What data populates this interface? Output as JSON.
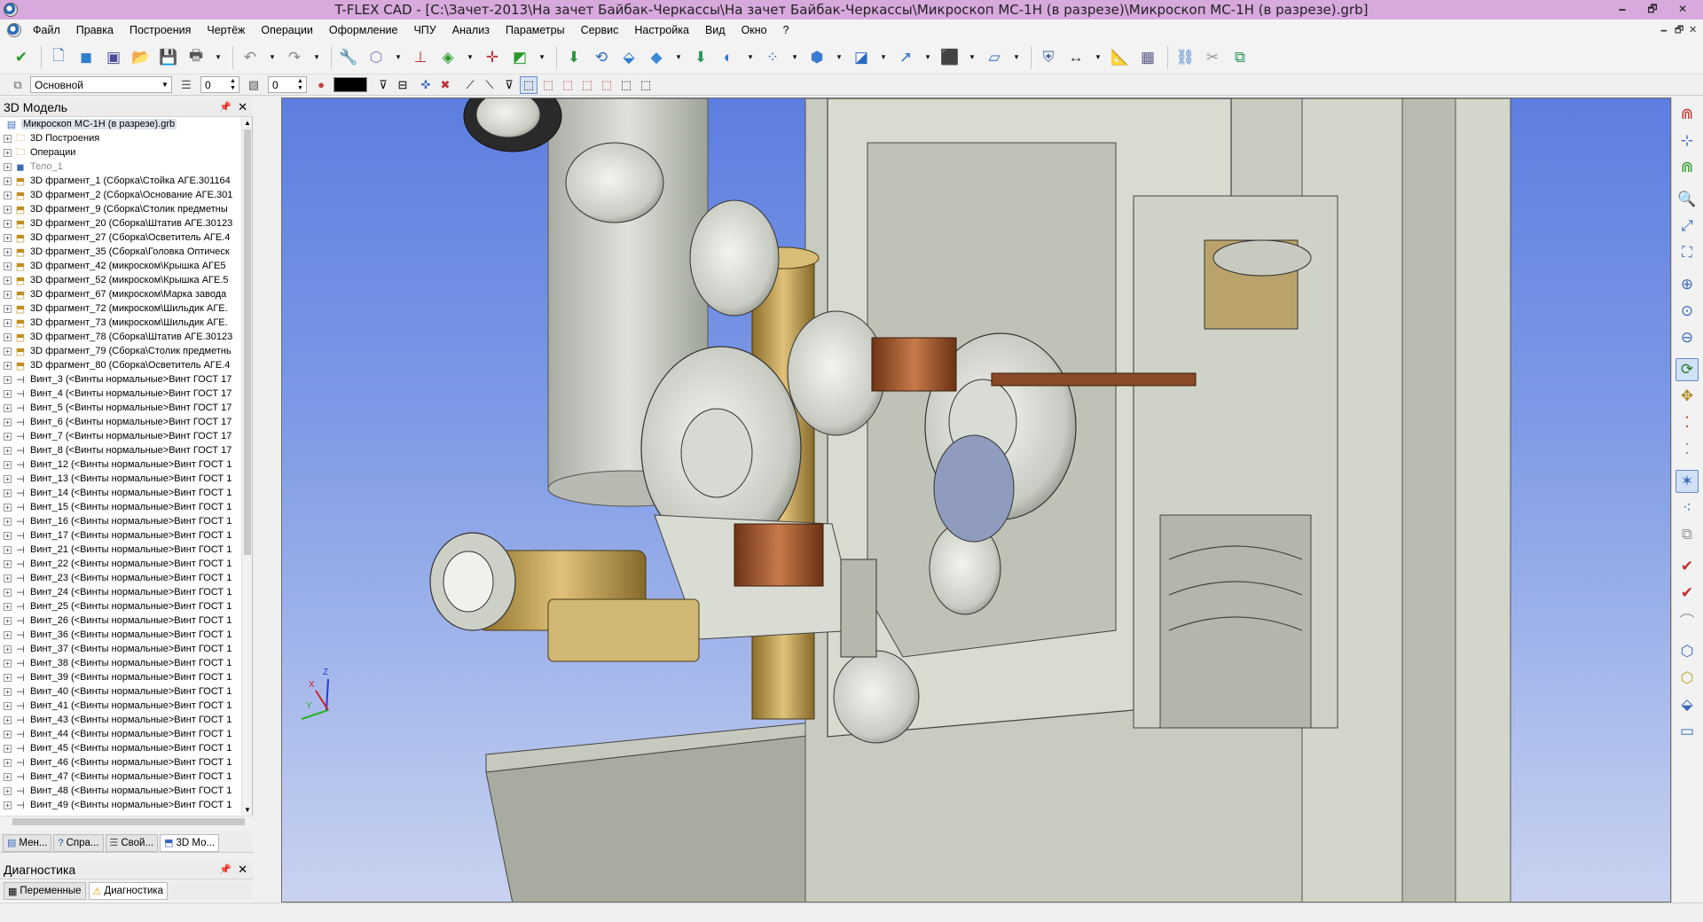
{
  "window": {
    "title": "T-FLEX CAD - [C:\\Зачет-2013\\На зачет Байбак-Черкассы\\На зачет Байбак-Черкассы\\Микроскоп МС-1Н (в разрезе)\\Микроскоп МС-1Н (в разрезе).grb]",
    "minimize": "🗕",
    "restore": "🗗",
    "close": "✕"
  },
  "menu": {
    "items": [
      "Файл",
      "Правка",
      "Построения",
      "Чертёж",
      "Операции",
      "Оформление",
      "ЧПУ",
      "Анализ",
      "Параметры",
      "Сервис",
      "Настройка",
      "Вид",
      "Окно",
      "?"
    ],
    "mdi_minimize": "🗕",
    "mdi_restore": "🗗",
    "mdi_close": "✕"
  },
  "toolbar2": {
    "layer": "Основной",
    "spin1": "0",
    "spin2": "0"
  },
  "model_panel": {
    "title": "3D Модель",
    "pin": "📌",
    "close": "✕",
    "tree": [
      {
        "label": "Микроскоп МС-1Н (в разрезе).grb",
        "icon": "document-icon",
        "root": true
      },
      {
        "label": "3D Построения",
        "icon": "folder-icon"
      },
      {
        "label": "Операции",
        "icon": "folder-icon"
      },
      {
        "label": "Тело_1",
        "icon": "body-icon",
        "dim": true
      },
      {
        "label": "3D фрагмент_1 (Сборка\\Стойка АГЕ.301164",
        "icon": "fragment-icon"
      },
      {
        "label": "3D фрагмент_2 (Сборка\\Основание АГЕ.301",
        "icon": "fragment-icon"
      },
      {
        "label": "3D фрагмент_9 (Сборка\\Столик предметны",
        "icon": "fragment-icon"
      },
      {
        "label": "3D фрагмент_20 (Сборка\\Штатив АГЕ.30123",
        "icon": "fragment-icon"
      },
      {
        "label": "3D фрагмент_27 (Сборка\\Осветитель АГЕ.4",
        "icon": "fragment-icon"
      },
      {
        "label": "3D фрагмент_35 (Сборка\\Головка Оптическ",
        "icon": "fragment-icon"
      },
      {
        "label": "3D фрагмент_42 (микроском\\Крышка АГЕ5",
        "icon": "fragment-icon"
      },
      {
        "label": "3D фрагмент_52 (микроском\\Крышка АГЕ.5",
        "icon": "fragment-icon"
      },
      {
        "label": "3D фрагмент_67 (микроском\\Марка завода",
        "icon": "fragment-icon"
      },
      {
        "label": "3D фрагмент_72 (микроском\\Шильдик АГЕ.",
        "icon": "fragment-icon"
      },
      {
        "label": "3D фрагмент_73 (микроском\\Шильдик АГЕ.",
        "icon": "fragment-icon"
      },
      {
        "label": "3D фрагмент_78 (Сборка\\Штатив АГЕ.30123",
        "icon": "fragment-icon"
      },
      {
        "label": "3D фрагмент_79 (Сборка\\Столик предметнь",
        "icon": "fragment-icon"
      },
      {
        "label": "3D фрагмент_80 (Сборка\\Осветитель АГЕ.4",
        "icon": "fragment-icon"
      },
      {
        "label": "Винт_3 (<Винты нормальные>Винт ГОСТ 17",
        "icon": "screw-icon"
      },
      {
        "label": "Винт_4 (<Винты нормальные>Винт ГОСТ 17",
        "icon": "screw-icon"
      },
      {
        "label": "Винт_5 (<Винты нормальные>Винт ГОСТ 17",
        "icon": "screw-icon"
      },
      {
        "label": "Винт_6 (<Винты нормальные>Винт ГОСТ 17",
        "icon": "screw-icon"
      },
      {
        "label": "Винт_7 (<Винты нормальные>Винт ГОСТ 17",
        "icon": "screw-icon"
      },
      {
        "label": "Винт_8 (<Винты нормальные>Винт ГОСТ 17",
        "icon": "screw-icon"
      },
      {
        "label": "Винт_12 (<Винты нормальные>Винт ГОСТ 1",
        "icon": "screw-icon"
      },
      {
        "label": "Винт_13 (<Винты нормальные>Винт ГОСТ 1",
        "icon": "screw-icon"
      },
      {
        "label": "Винт_14 (<Винты нормальные>Винт ГОСТ 1",
        "icon": "screw-icon"
      },
      {
        "label": "Винт_15 (<Винты нормальные>Винт ГОСТ 1",
        "icon": "screw-icon"
      },
      {
        "label": "Винт_16 (<Винты нормальные>Винт ГОСТ 1",
        "icon": "screw-icon"
      },
      {
        "label": "Винт_17 (<Винты нормальные>Винт ГОСТ 1",
        "icon": "screw-icon"
      },
      {
        "label": "Винт_21 (<Винты нормальные>Винт ГОСТ 1",
        "icon": "screw-icon"
      },
      {
        "label": "Винт_22 (<Винты нормальные>Винт ГОСТ 1",
        "icon": "screw-icon"
      },
      {
        "label": "Винт_23 (<Винты нормальные>Винт ГОСТ 1",
        "icon": "screw-icon"
      },
      {
        "label": "Винт_24 (<Винты нормальные>Винт ГОСТ 1",
        "icon": "screw-icon"
      },
      {
        "label": "Винт_25 (<Винты нормальные>Винт ГОСТ 1",
        "icon": "screw-icon"
      },
      {
        "label": "Винт_26 (<Винты нормальные>Винт ГОСТ 1",
        "icon": "screw-icon"
      },
      {
        "label": "Винт_36 (<Винты нормальные>Винт ГОСТ 1",
        "icon": "screw-icon"
      },
      {
        "label": "Винт_37 (<Винты нормальные>Винт ГОСТ 1",
        "icon": "screw-icon"
      },
      {
        "label": "Винт_38 (<Винты нормальные>Винт ГОСТ 1",
        "icon": "screw-icon"
      },
      {
        "label": "Винт_39 (<Винты нормальные>Винт ГОСТ 1",
        "icon": "screw-icon"
      },
      {
        "label": "Винт_40 (<Винты нормальные>Винт ГОСТ 1",
        "icon": "screw-icon"
      },
      {
        "label": "Винт_41 (<Винты нормальные>Винт ГОСТ 1",
        "icon": "screw-icon"
      },
      {
        "label": "Винт_43 (<Винты нормальные>Винт ГОСТ 1",
        "icon": "screw-icon"
      },
      {
        "label": "Винт_44 (<Винты нормальные>Винт ГОСТ 1",
        "icon": "screw-icon"
      },
      {
        "label": "Винт_45 (<Винты нормальные>Винт ГОСТ 1",
        "icon": "screw-icon"
      },
      {
        "label": "Винт_46 (<Винты нормальные>Винт ГОСТ 1",
        "icon": "screw-icon"
      },
      {
        "label": "Винт_47 (<Винты нормальные>Винт ГОСТ 1",
        "icon": "screw-icon"
      },
      {
        "label": "Винт_48 (<Винты нормальные>Винт ГОСТ 1",
        "icon": "screw-icon"
      },
      {
        "label": "Винт_49 (<Винты нормальные>Винт ГОСТ 1",
        "icon": "screw-icon"
      }
    ],
    "tabs": [
      "Мен...",
      "Спра...",
      "Свой...",
      "3D Мо..."
    ]
  },
  "diag_panel": {
    "title": "Диагностика",
    "pin": "📌",
    "close": "✕",
    "tabs": [
      "Переменные",
      "Диагностика"
    ]
  },
  "viewport": {
    "axis_z": "Z",
    "axis_x": "X",
    "axis_y": "Y"
  },
  "colors": {
    "title_bg": "#d7a9dc",
    "viewport_top": "#5c7ee0",
    "viewport_bottom": "#c9d3f0",
    "part_gray": "#c9ccc4",
    "part_brass": "#b99a4a",
    "part_copper": "#a0562e"
  }
}
